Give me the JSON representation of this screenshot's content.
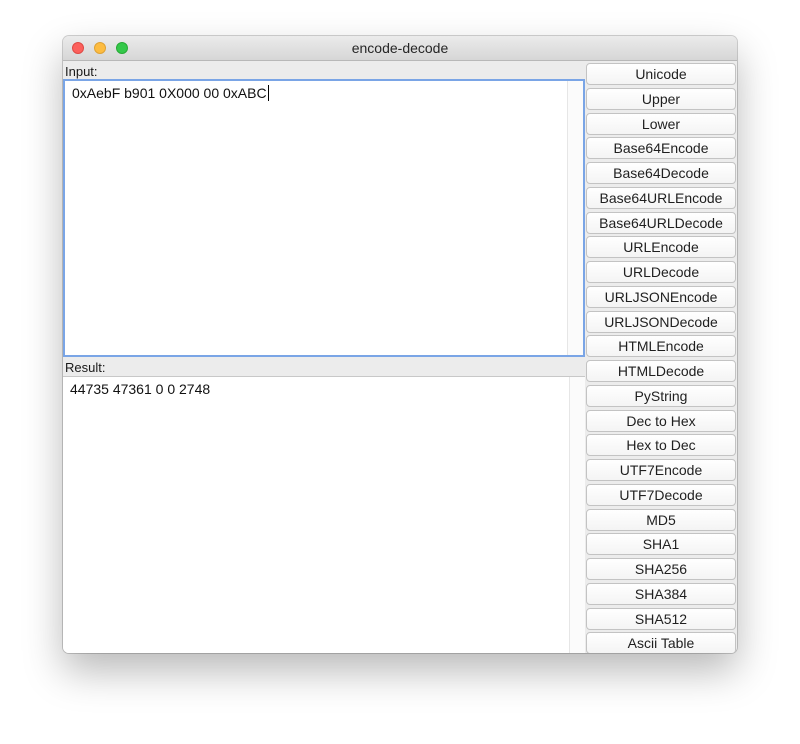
{
  "window": {
    "title": "encode-decode"
  },
  "input": {
    "label": "Input:",
    "value": "0xAebF b901 0X000 00 0xABC"
  },
  "result": {
    "label": "Result:",
    "value": "44735 47361 0 0 2748"
  },
  "buttons": [
    {
      "label": "Unicode"
    },
    {
      "label": "Upper"
    },
    {
      "label": "Lower"
    },
    {
      "label": "Base64Encode"
    },
    {
      "label": "Base64Decode"
    },
    {
      "label": "Base64URLEncode"
    },
    {
      "label": "Base64URLDecode"
    },
    {
      "label": "URLEncode"
    },
    {
      "label": "URLDecode"
    },
    {
      "label": "URLJSONEncode"
    },
    {
      "label": "URLJSONDecode"
    },
    {
      "label": "HTMLEncode"
    },
    {
      "label": "HTMLDecode"
    },
    {
      "label": "PyString"
    },
    {
      "label": "Dec to Hex"
    },
    {
      "label": "Hex to Dec"
    },
    {
      "label": "UTF7Encode"
    },
    {
      "label": "UTF7Decode"
    },
    {
      "label": "MD5"
    },
    {
      "label": "SHA1"
    },
    {
      "label": "SHA256"
    },
    {
      "label": "SHA384"
    },
    {
      "label": "SHA512"
    },
    {
      "label": "Ascii Table"
    }
  ]
}
